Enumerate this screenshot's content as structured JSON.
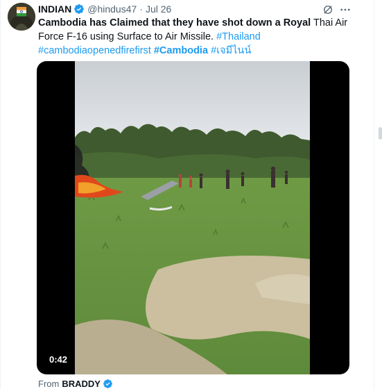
{
  "tweet": {
    "author_name": "INDIAN",
    "handle": "@hindus47",
    "separator": "·",
    "date": "Jul 26",
    "text_bold": "Cambodia has Claimed that they have shot down a Royal",
    "text_plain": " Thai Air Force F-16 using Surface to Air Missile. ",
    "hashtags": [
      "#Thailand",
      "#cambodiaopenedfirefirst",
      "#Cambodia",
      "#เจมีไนน์"
    ]
  },
  "media": {
    "duration": "0:42"
  },
  "source": {
    "label": "From",
    "name": "BRADDY"
  },
  "icons": {
    "verified": "verified-badge-icon",
    "grok": "grok-icon",
    "more": "more-options-icon"
  },
  "colors": {
    "link": "#1d9bf0",
    "verified": "#1d9bf0",
    "secondary_text": "#536471"
  }
}
